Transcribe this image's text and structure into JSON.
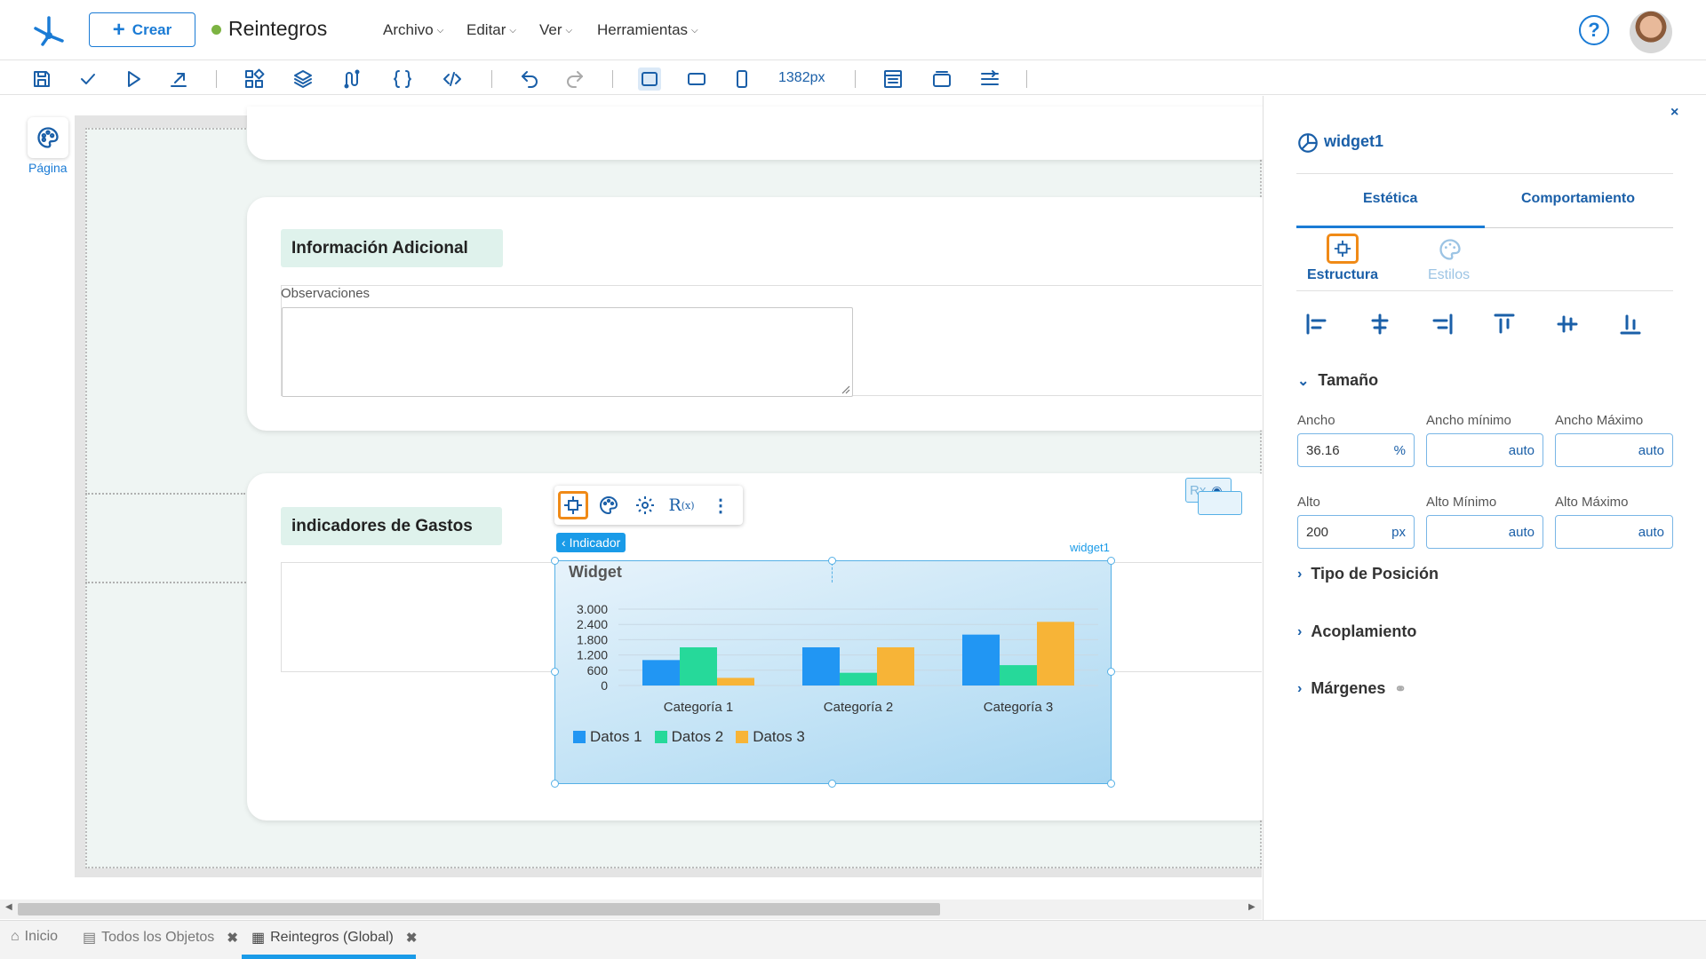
{
  "header": {
    "create_label": "Crear",
    "app_title": "Reintegros",
    "menus": [
      "Archivo",
      "Editar",
      "Ver",
      "Herramientas"
    ]
  },
  "toolbar": {
    "width_label": "1382px"
  },
  "left": {
    "page_label": "Página"
  },
  "form": {
    "section1_title": "Información Adicional",
    "observations_label": "Observaciones",
    "section2_title": "indicadores de Gastos"
  },
  "widget": {
    "tag": "Indicador",
    "name": "widget1",
    "title": "Widget",
    "rx_label": "Rx"
  },
  "chart_data": {
    "type": "bar",
    "title": "Widget",
    "categories": [
      "Categoría 1",
      "Categoría 2",
      "Categoría 3"
    ],
    "series": [
      {
        "name": "Datos 1",
        "values": [
          1000,
          1500,
          2000
        ],
        "color": "#2196f3"
      },
      {
        "name": "Datos 2",
        "values": [
          1500,
          500,
          800
        ],
        "color": "#26d99a"
      },
      {
        "name": "Datos 3",
        "values": [
          300,
          1500,
          2500
        ],
        "color": "#f7b437"
      }
    ],
    "y_ticks": [
      "3.000",
      "2.400",
      "1.800",
      "1.200",
      "600",
      "0"
    ],
    "ylim": [
      0,
      3000
    ],
    "legend_position": "bottom-left",
    "grid": true
  },
  "panel": {
    "title": "widget1",
    "tabs": [
      "Estética",
      "Comportamiento"
    ],
    "subtabs": [
      "Estructura",
      "Estilos"
    ],
    "size_section": "Tamaño",
    "fields": {
      "ancho_label": "Ancho",
      "ancho_value": "36.16",
      "ancho_unit": "%",
      "ancho_min_label": "Ancho mínimo",
      "ancho_max_label": "Ancho Máximo",
      "alto_label": "Alto",
      "alto_value": "200",
      "alto_unit": "px",
      "alto_min_label": "Alto Mínimo",
      "alto_max_label": "Alto Máximo",
      "auto": "auto"
    },
    "sections": [
      "Tipo de Posición",
      "Acoplamiento",
      "Márgenes"
    ],
    "close": "×"
  },
  "bottom_tabs": [
    {
      "label": "Inicio"
    },
    {
      "label": "Todos los Objetos",
      "close": "✖"
    },
    {
      "label": "Reintegros (Global)",
      "close": "✖"
    }
  ],
  "colors": {
    "accent": "#1a7bd5",
    "selection": "#f08a17",
    "section_bg": "#dff2ec"
  }
}
